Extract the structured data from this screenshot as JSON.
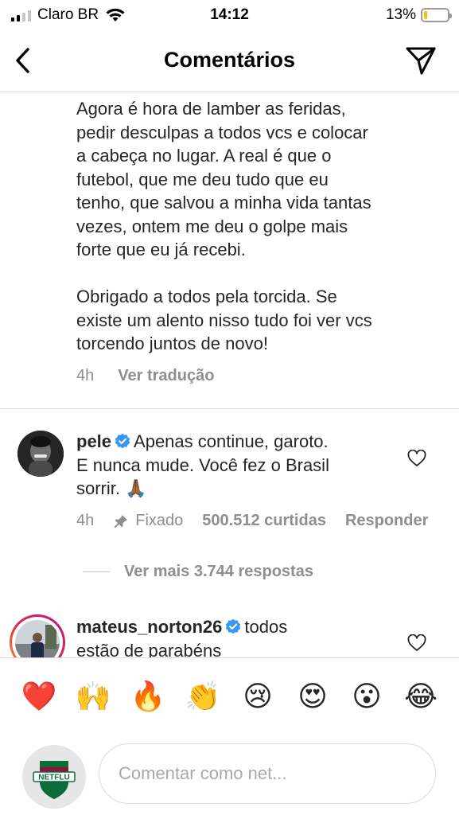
{
  "status_bar": {
    "carrier": "Claro BR",
    "time": "14:12",
    "battery_percent": "13%",
    "battery_level": 0.13,
    "battery_color": "#f5c400"
  },
  "header": {
    "title": "Comentários",
    "back_icon": "chevron-left-icon",
    "send_icon": "paper-plane-icon"
  },
  "caption": {
    "paragraph1": "Agora é hora de lamber as feridas,\npedir desculpas a todos vcs e colocar\na cabeça no lugar. A real é que o\nfutebol, que me deu tudo que eu\ntenho, que salvou a minha vida tantas\nvezes, ontem me deu o golpe mais\nforte que eu já recebi.",
    "paragraph2": "Obrigado a todos pela torcida. Se\nexiste um alento nisso tudo foi ver vcs\ntorcendo juntos de novo!",
    "time": "4h",
    "translate": "Ver tradução"
  },
  "comments": [
    {
      "username": "pele",
      "verified": true,
      "text_line1": "Apenas continue, garoto.",
      "text_rest": "E nunca mude. Você fez o Brasil\nsorrir. 🙏🏾",
      "time": "4h",
      "pinned_label": "Fixado",
      "likes": "500.512 curtidas",
      "reply": "Responder",
      "view_replies": "Ver mais 3.744 respostas"
    },
    {
      "username": "mateus_norton26",
      "verified": true,
      "text_line1": "todos",
      "text_rest": "estão de parabéns"
    }
  ],
  "emoji_bar": [
    "❤️",
    "🙌",
    "🔥",
    "👏",
    "😢",
    "😍",
    "😮",
    "😂"
  ],
  "composer": {
    "placeholder": "Comentar como net...",
    "avatar_text": "NETFLU"
  },
  "colors": {
    "verified_blue": "#3897f0",
    "muted_text": "#8e8e8e",
    "story_ring_start": "#f09433",
    "story_ring_end": "#bc1888"
  }
}
